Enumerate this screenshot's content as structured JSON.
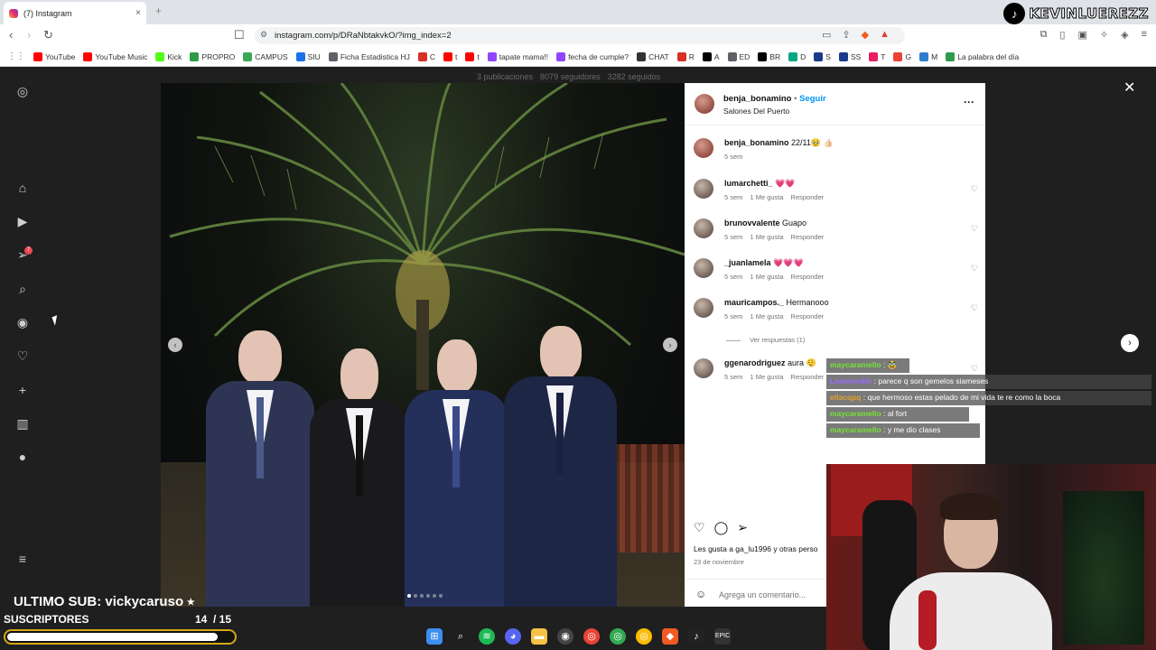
{
  "browser": {
    "tab_title": "(7) Instagram",
    "tab_close": "×",
    "new_tab": "+",
    "url": "instagram.com/p/DRaNbtakvkO/?img_index=2",
    "tiktok_user": "KEVINLUEREZZ",
    "bookmarks": [
      {
        "label": "YouTube",
        "color": "#ff0000"
      },
      {
        "label": "YouTube Music",
        "color": "#ff0000"
      },
      {
        "label": "Kick",
        "color": "#53fc18"
      },
      {
        "label": "PROPRO",
        "color": "#2e9b4a"
      },
      {
        "label": "CAMPUS",
        "color": "#3aa757"
      },
      {
        "label": "SIU",
        "color": "#1a73e8"
      },
      {
        "label": "Ficha Estadistica HJ",
        "color": "#5f6368"
      },
      {
        "label": "C",
        "color": "#d93025"
      },
      {
        "label": "t",
        "color": "#ff0000"
      },
      {
        "label": "t",
        "color": "#ff0000"
      },
      {
        "label": "tapate mama!!",
        "color": "#9146ff"
      },
      {
        "label": "fecha de cumple?",
        "color": "#9146ff"
      },
      {
        "label": "CHAT",
        "color": "#333333"
      },
      {
        "label": "R",
        "color": "#d93025"
      },
      {
        "label": "A",
        "color": "#000000"
      },
      {
        "label": "ED",
        "color": "#5f6368"
      },
      {
        "label": "BR",
        "color": "#000000"
      },
      {
        "label": "D",
        "color": "#00a884"
      },
      {
        "label": "S",
        "color": "#1a3a8a"
      },
      {
        "label": "SS",
        "color": "#1a3a8a"
      },
      {
        "label": "T",
        "color": "#e91e63"
      },
      {
        "label": "G",
        "color": "#ea4335"
      },
      {
        "label": "M",
        "color": "#2e7dd1"
      },
      {
        "label": "La palabra del día",
        "color": "#2e9b4a"
      }
    ]
  },
  "profile_stats": {
    "posts": "3 publicaciones",
    "followers": "8079 seguidores",
    "following": "3282 seguidos"
  },
  "post": {
    "username": "benja_bonamino",
    "dot": "•",
    "follow": "Seguir",
    "location": "Salones Del Puerto",
    "more": "···",
    "caption_user": "benja_bonamino",
    "caption_text": "22/11🥹 👍🏻",
    "caption_time": "5 sem",
    "comments": [
      {
        "user": "lumarchetti_",
        "text": "💗💗",
        "time": "5 sem",
        "likes": "1 Me gusta",
        "reply": "Responder"
      },
      {
        "user": "brunovvalente",
        "text": "Guapo",
        "time": "5 sem",
        "likes": "1 Me gusta",
        "reply": "Responder"
      },
      {
        "user": "_juanlamela",
        "text": "💗💗💗",
        "time": "5 sem",
        "likes": "1 Me gusta",
        "reply": "Responder"
      },
      {
        "user": "mauricampos._",
        "text": "Hermanooo",
        "time": "5 sem",
        "likes": "1 Me gusta",
        "reply": "Responder"
      },
      {
        "user": "ggenarodriguez",
        "text": "aura 😮‍💨",
        "time": "5 sem",
        "likes": "1 Me gusta",
        "reply": "Responder"
      }
    ],
    "view_replies": "Ver respuestas (1)",
    "liked_by": "Les gusta a ga_lu1996 y otras perso",
    "date": "23 de noviembre",
    "add_comment_placeholder": "Agrega un comentario..."
  },
  "chat": [
    {
      "user": "maycaramello",
      "sep": ":",
      "msg": "🥸",
      "color": "#76e336"
    },
    {
      "user": "Leannonblr",
      "sep": ":",
      "msg": "parece q son gemelos siameses",
      "color": "#9b6cff"
    },
    {
      "user": "ellacqpq",
      "sep": ":",
      "msg": "que hermoso estas pelado de mi vida te re como la boca",
      "color": "#e0a030"
    },
    {
      "user": "maycaramello",
      "sep": ":",
      "msg": "al fort",
      "color": "#76e336"
    },
    {
      "user": "maycaramello",
      "sep": ":",
      "msg": "y me dio clases",
      "color": "#76e336"
    }
  ],
  "overlay": {
    "last_sub": "ULTIMO SUB: vickycaruso ⭑",
    "subs_label": "SUSCRIPTORES",
    "subs_count": "14",
    "subs_goal": "/ 15",
    "subs_progress": 0.93
  }
}
